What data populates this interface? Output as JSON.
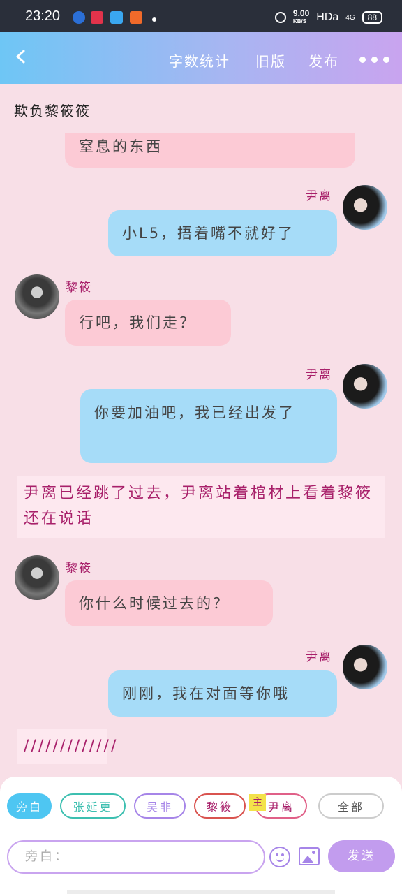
{
  "status_bar": {
    "time": "23:20",
    "net_speed": "9.00",
    "net_unit": "KB/S",
    "hd": "HDa",
    "signal": "4G",
    "battery": "88"
  },
  "header": {
    "back_icon": "chevron-left-icon",
    "word_count": "字数统计",
    "old_version": "旧版",
    "publish": "发布",
    "more_icon": "more-dots-icon"
  },
  "chat": {
    "title": "欺负黎筱筱",
    "messages": [
      {
        "type": "left",
        "name": "",
        "text": "窒息的东西"
      },
      {
        "type": "right",
        "name": "尹离",
        "text": "小L5，捂着嘴不就好了"
      },
      {
        "type": "left",
        "name": "黎筱",
        "text": "行吧，我们走？"
      },
      {
        "type": "right",
        "name": "尹离",
        "text": "你要加油吧，我已经出发了"
      },
      {
        "type": "narration",
        "text": "尹离已经跳了过去，尹离站着棺材上看着黎筱还在说话"
      },
      {
        "type": "left",
        "name": "黎筱",
        "text": "你什么时候过去的？"
      },
      {
        "type": "right",
        "name": "尹离",
        "text": "刚刚，我在对面等你哦"
      },
      {
        "type": "narration",
        "text": "/////////////"
      }
    ]
  },
  "roles": {
    "items": [
      "旁白",
      "张延更",
      "吴非",
      "黎筱",
      "尹离",
      "全部"
    ],
    "tag": "主",
    "colors": [
      "#4ec6f2",
      "#3cbfb0",
      "#a685e8",
      "#d9534f",
      "#e06088",
      "#bbbbbb"
    ]
  },
  "composer": {
    "placeholder": "旁白：",
    "send": "发送",
    "emoji_icon": "smile-icon",
    "image_icon": "image-icon"
  }
}
